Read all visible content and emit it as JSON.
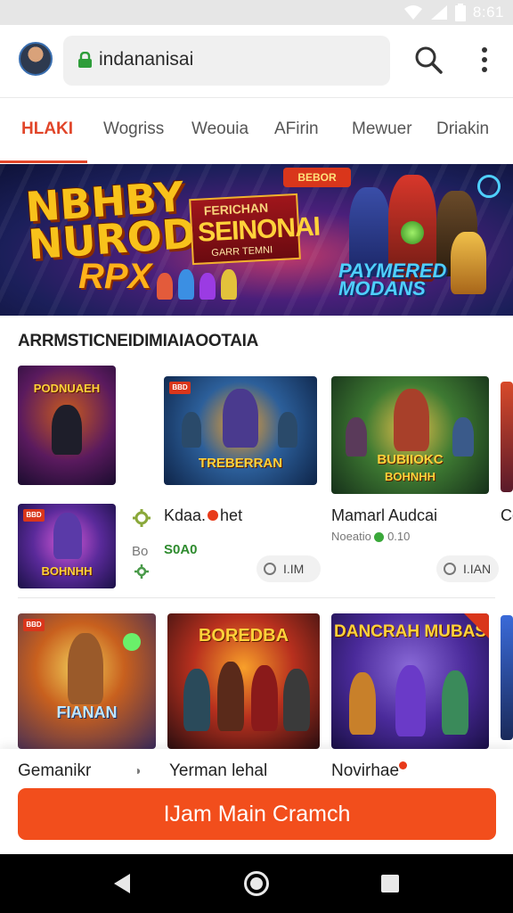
{
  "status_bar": {
    "time": "8:61"
  },
  "browser": {
    "url": "indananisai",
    "icons": [
      "avatar",
      "lock-icon",
      "search-icon",
      "more-vert-icon"
    ]
  },
  "tabs": [
    {
      "label": "HLAKI",
      "active": true
    },
    {
      "label": "Wogriss",
      "active": false
    },
    {
      "label": "Weouia",
      "active": false
    },
    {
      "label": "AFirin",
      "active": false
    },
    {
      "label": "Mewuer",
      "active": false
    },
    {
      "label": "Driakin",
      "active": false
    }
  ],
  "banner": {
    "title_line1": "NBHBY",
    "title_line2": "NURODICS",
    "title_line3": "RPX",
    "tag": "BEBOR",
    "badge_sub": "FERICHAN",
    "badge_main": "SEINONAI",
    "badge_foot": "GARR TEMNI",
    "right_title": "PAYMERED MODANS"
  },
  "section": {
    "title": "ARRMSTICNEIDIMIAIAOOTAIA"
  },
  "tiles": {
    "t1": {
      "label": "PODNUAEH"
    },
    "t2": {
      "label": "TREBERRAN",
      "badge": "BBD"
    },
    "t3": {
      "label": "BUBIIOKC",
      "label2": "BOHNHH"
    },
    "t4": {
      "label": "BOHNHH",
      "badge": "BBD"
    },
    "t5": {
      "label": "FIANAN",
      "badge": "BBD"
    },
    "t6": {
      "label": "BOREDBA"
    },
    "t7": {
      "label": "DANCRAH MUBAS"
    }
  },
  "cards": {
    "c1": {
      "name": "Kdaa.",
      "name2": "het",
      "price_prefix": "Bo",
      "price": "S0A0",
      "pill": "I.IM"
    },
    "c2": {
      "name": "Mamarl Audcai",
      "sub": "Noeatio",
      "sub2": "0.10",
      "pill": "I.IAN"
    },
    "c3": {
      "name": "Co"
    }
  },
  "bottom_sheet": {
    "items": [
      "Gemanikr",
      "Yerman lehal",
      "Novirhae"
    ],
    "cta": "IJam Main Cramch"
  },
  "colors": {
    "accent": "#f24e1c",
    "tab_active": "#e1462a",
    "price": "#2e8b2e"
  }
}
